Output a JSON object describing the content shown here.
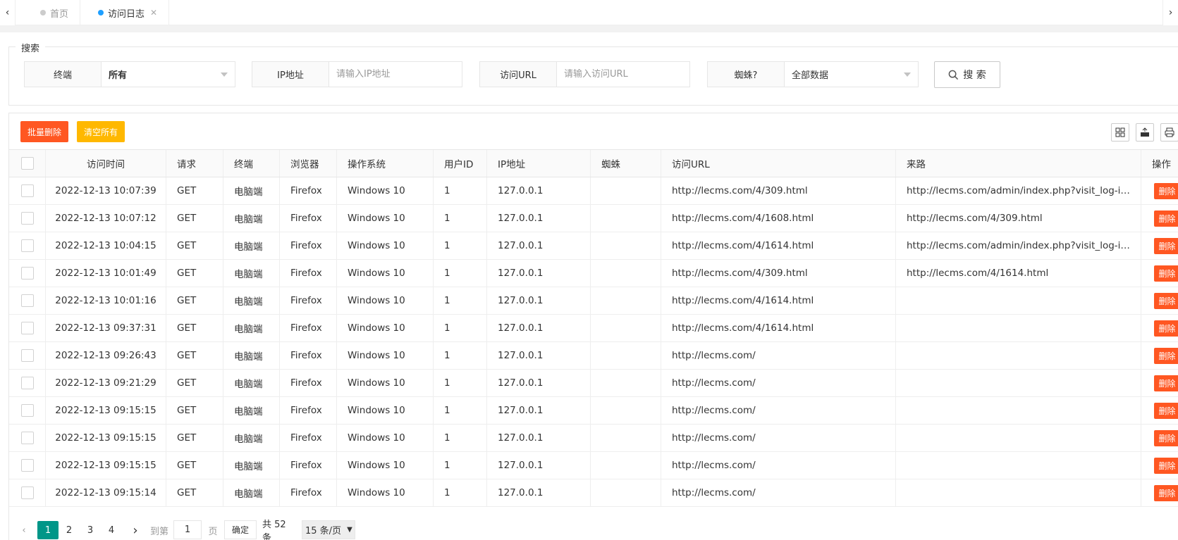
{
  "tabs": [
    {
      "label": "首页",
      "active": false
    },
    {
      "label": "访问日志",
      "active": true
    }
  ],
  "search": {
    "legend": "搜索",
    "fields": [
      {
        "label": "终端",
        "value": "所有",
        "type": "select"
      },
      {
        "label": "IP地址",
        "placeholder": "请输入IP地址",
        "type": "input"
      },
      {
        "label": "访问URL",
        "placeholder": "请输入访问URL",
        "type": "input"
      },
      {
        "label": "蜘蛛?",
        "value": "全部数据",
        "type": "select"
      }
    ],
    "button_label": "搜 索"
  },
  "toolbar": {
    "batch_delete": "批量删除",
    "clear_all": "清空所有"
  },
  "columns": [
    "访问时间",
    "请求",
    "终端",
    "浏览器",
    "操作系统",
    "用户ID",
    "IP地址",
    "蜘蛛",
    "访问URL",
    "来路",
    "操作"
  ],
  "rows": [
    {
      "time": "2022-12-13 10:07:39",
      "method": "GET",
      "terminal": "电脑端",
      "browser": "Firefox",
      "os": "Windows 10",
      "uid": "1",
      "ip": "127.0.0.1",
      "spider": "",
      "url": "http://lecms.com/4/309.html",
      "referer": "http://lecms.com/admin/index.php?visit_log-index"
    },
    {
      "time": "2022-12-13 10:07:12",
      "method": "GET",
      "terminal": "电脑端",
      "browser": "Firefox",
      "os": "Windows 10",
      "uid": "1",
      "ip": "127.0.0.1",
      "spider": "",
      "url": "http://lecms.com/4/1608.html",
      "referer": "http://lecms.com/4/309.html"
    },
    {
      "time": "2022-12-13 10:04:15",
      "method": "GET",
      "terminal": "电脑端",
      "browser": "Firefox",
      "os": "Windows 10",
      "uid": "1",
      "ip": "127.0.0.1",
      "spider": "",
      "url": "http://lecms.com/4/1614.html",
      "referer": "http://lecms.com/admin/index.php?visit_log-index"
    },
    {
      "time": "2022-12-13 10:01:49",
      "method": "GET",
      "terminal": "电脑端",
      "browser": "Firefox",
      "os": "Windows 10",
      "uid": "1",
      "ip": "127.0.0.1",
      "spider": "",
      "url": "http://lecms.com/4/309.html",
      "referer": "http://lecms.com/4/1614.html"
    },
    {
      "time": "2022-12-13 10:01:16",
      "method": "GET",
      "terminal": "电脑端",
      "browser": "Firefox",
      "os": "Windows 10",
      "uid": "1",
      "ip": "127.0.0.1",
      "spider": "",
      "url": "http://lecms.com/4/1614.html",
      "referer": ""
    },
    {
      "time": "2022-12-13 09:37:31",
      "method": "GET",
      "terminal": "电脑端",
      "browser": "Firefox",
      "os": "Windows 10",
      "uid": "1",
      "ip": "127.0.0.1",
      "spider": "",
      "url": "http://lecms.com/4/1614.html",
      "referer": ""
    },
    {
      "time": "2022-12-13 09:26:43",
      "method": "GET",
      "terminal": "电脑端",
      "browser": "Firefox",
      "os": "Windows 10",
      "uid": "1",
      "ip": "127.0.0.1",
      "spider": "",
      "url": "http://lecms.com/",
      "referer": ""
    },
    {
      "time": "2022-12-13 09:21:29",
      "method": "GET",
      "terminal": "电脑端",
      "browser": "Firefox",
      "os": "Windows 10",
      "uid": "1",
      "ip": "127.0.0.1",
      "spider": "",
      "url": "http://lecms.com/",
      "referer": ""
    },
    {
      "time": "2022-12-13 09:15:15",
      "method": "GET",
      "terminal": "电脑端",
      "browser": "Firefox",
      "os": "Windows 10",
      "uid": "1",
      "ip": "127.0.0.1",
      "spider": "",
      "url": "http://lecms.com/",
      "referer": ""
    },
    {
      "time": "2022-12-13 09:15:15",
      "method": "GET",
      "terminal": "电脑端",
      "browser": "Firefox",
      "os": "Windows 10",
      "uid": "1",
      "ip": "127.0.0.1",
      "spider": "",
      "url": "http://lecms.com/",
      "referer": ""
    },
    {
      "time": "2022-12-13 09:15:15",
      "method": "GET",
      "terminal": "电脑端",
      "browser": "Firefox",
      "os": "Windows 10",
      "uid": "1",
      "ip": "127.0.0.1",
      "spider": "",
      "url": "http://lecms.com/",
      "referer": ""
    },
    {
      "time": "2022-12-13 09:15:14",
      "method": "GET",
      "terminal": "电脑端",
      "browser": "Firefox",
      "os": "Windows 10",
      "uid": "1",
      "ip": "127.0.0.1",
      "spider": "",
      "url": "http://lecms.com/",
      "referer": ""
    }
  ],
  "row_action": "删除",
  "pager": {
    "pages": [
      "1",
      "2",
      "3",
      "4"
    ],
    "current": "1",
    "goto_label": "到第",
    "goto_value": "1",
    "page_unit": "页",
    "confirm": "确定",
    "total": "共 52 条",
    "page_size": "15 条/页"
  },
  "colors": {
    "danger": "#FF5722",
    "warn": "#FFB800",
    "primary": "#009688",
    "tab_active_dot": "#1E9FFF"
  }
}
